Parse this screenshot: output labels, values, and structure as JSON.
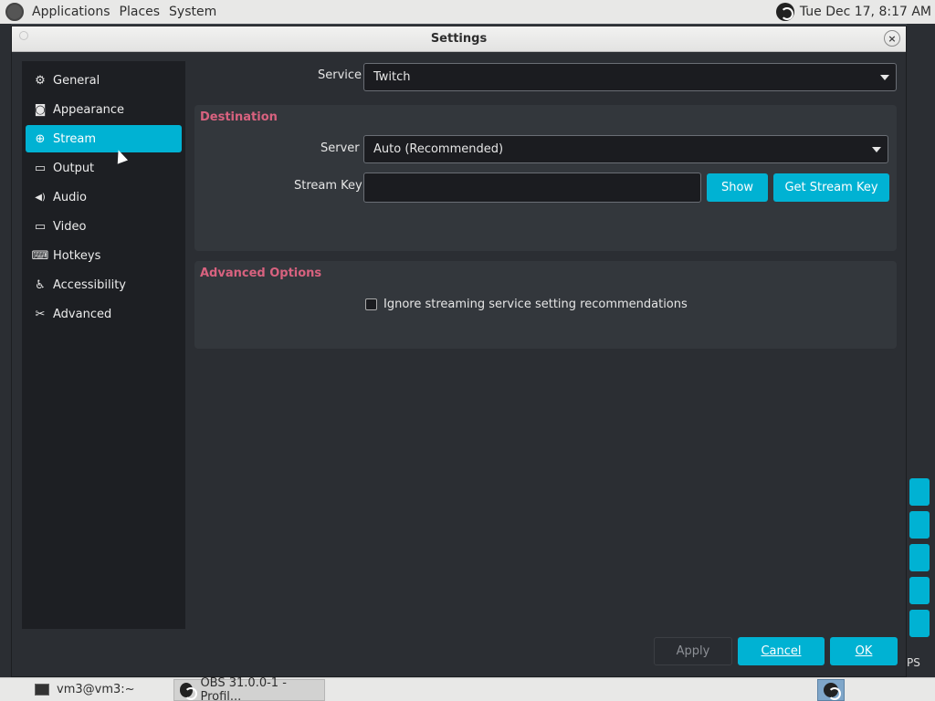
{
  "top_panel": {
    "menus": [
      "Applications",
      "Places",
      "System"
    ],
    "clock": "Tue Dec 17,  8:17 AM"
  },
  "dialog": {
    "title": "Settings",
    "close_glyph": "×"
  },
  "sidebar": {
    "items": [
      {
        "label": "General",
        "icon": "gear-icon",
        "glyph": "⚙"
      },
      {
        "label": "Appearance",
        "icon": "appearance-icon",
        "glyph": "◙"
      },
      {
        "label": "Stream",
        "icon": "stream-antenna-icon",
        "glyph": "⊕",
        "active": true
      },
      {
        "label": "Output",
        "icon": "output-icon",
        "glyph": "▭"
      },
      {
        "label": "Audio",
        "icon": "speaker-icon",
        "glyph": "◀)"
      },
      {
        "label": "Video",
        "icon": "monitor-icon",
        "glyph": "▭"
      },
      {
        "label": "Hotkeys",
        "icon": "keyboard-icon",
        "glyph": "⌨"
      },
      {
        "label": "Accessibility",
        "icon": "accessibility-icon",
        "glyph": "♿"
      },
      {
        "label": "Advanced",
        "icon": "tools-icon",
        "glyph": "✂"
      }
    ]
  },
  "stream": {
    "service_label": "Service",
    "service_value": "Twitch",
    "destination": {
      "title": "Destination",
      "server_label": "Server",
      "server_value": "Auto (Recommended)",
      "stream_key_label": "Stream Key",
      "stream_key_value": "",
      "show_label": "Show",
      "get_key_label": "Get Stream Key"
    },
    "advanced": {
      "title": "Advanced Options",
      "ignore_label": "Ignore streaming service setting recommendations",
      "ignore_checked": false
    }
  },
  "footer": {
    "apply_label": "Apply",
    "cancel_label": "Cancel",
    "ok_label": "OK"
  },
  "taskbar": {
    "tasks": [
      {
        "label": "vm3@vm3:~"
      },
      {
        "label": "OBS 31.0.0-1 - Profil..."
      }
    ]
  },
  "background": {
    "fps_fragment": "PS"
  },
  "colors": {
    "accent": "#00b2d3",
    "section_title": "#d8627f",
    "dialog_bg": "#2b2e33",
    "sidebar_bg": "#1d1f23"
  }
}
